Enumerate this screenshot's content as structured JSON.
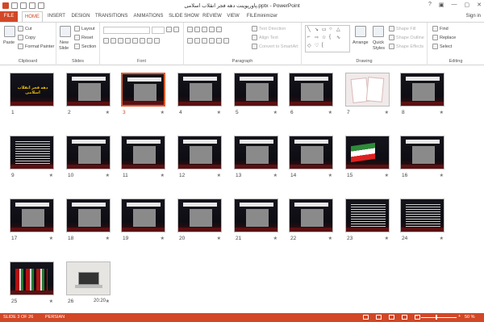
{
  "window": {
    "title": "پاورپوینت دهه فجر انقلاب اسلامی.pptx - PowerPoint",
    "controls": [
      "?",
      "▣",
      "—",
      "▢",
      "✕"
    ]
  },
  "tabs": [
    {
      "label": "FILE"
    },
    {
      "label": "HOME"
    },
    {
      "label": "INSERT"
    },
    {
      "label": "DESIGN"
    },
    {
      "label": "TRANSITIONS"
    },
    {
      "label": "ANIMATIONS"
    },
    {
      "label": "SLIDE SHOW"
    },
    {
      "label": "REVIEW"
    },
    {
      "label": "VIEW"
    },
    {
      "label": "FILEminimizer"
    }
  ],
  "active_tab": "HOME",
  "signin": "Sign in",
  "ribbon": {
    "clipboard": {
      "label": "Clipboard",
      "paste": "Paste",
      "cut": "Cut",
      "copy": "Copy",
      "format_painter": "Format Painter"
    },
    "slides": {
      "label": "Slides",
      "new_slide": "New",
      "new_slide2": "Slide",
      "layout": "Layout",
      "reset": "Reset",
      "section": "Section"
    },
    "font": {
      "label": "Font"
    },
    "paragraph": {
      "label": "Paragraph",
      "text_direction": "Text Direction",
      "align_text": "Align Text",
      "convert_smartart": "Convert to SmartArt"
    },
    "drawing": {
      "label": "Drawing",
      "arrange": "Arrange",
      "quick_styles": "Quick",
      "quick_styles2": "Styles",
      "shape_fill": "Shape Fill",
      "shape_outline": "Shape Outline",
      "shape_effects": "Shape Effects"
    },
    "editing": {
      "label": "Editing",
      "find": "Find",
      "replace": "Replace",
      "select": "Select"
    }
  },
  "slides": [
    {
      "num": "1",
      "kind": "title",
      "title_text": "دهه فجر انقلاب اسلامی",
      "star": ""
    },
    {
      "num": "2",
      "kind": "photo",
      "star": "★"
    },
    {
      "num": "3",
      "kind": "photo",
      "star": "★",
      "selected": true
    },
    {
      "num": "4",
      "kind": "photo",
      "star": "★"
    },
    {
      "num": "5",
      "kind": "photo",
      "star": "★"
    },
    {
      "num": "6",
      "kind": "photo",
      "star": "★"
    },
    {
      "num": "7",
      "kind": "paper",
      "star": "★"
    },
    {
      "num": "8",
      "kind": "photo",
      "star": "★"
    },
    {
      "num": "9",
      "kind": "text",
      "star": "★"
    },
    {
      "num": "10",
      "kind": "photo",
      "star": "★"
    },
    {
      "num": "11",
      "kind": "photo",
      "star": "★"
    },
    {
      "num": "12",
      "kind": "photo",
      "star": "★"
    },
    {
      "num": "13",
      "kind": "photo",
      "star": "★"
    },
    {
      "num": "14",
      "kind": "photo",
      "star": "★"
    },
    {
      "num": "15",
      "kind": "flag",
      "star": "★"
    },
    {
      "num": "16",
      "kind": "photo",
      "star": "★"
    },
    {
      "num": "17",
      "kind": "photo",
      "star": "★"
    },
    {
      "num": "18",
      "kind": "photo",
      "star": "★"
    },
    {
      "num": "19",
      "kind": "photo",
      "star": "★"
    },
    {
      "num": "20",
      "kind": "photo",
      "star": "★"
    },
    {
      "num": "21",
      "kind": "photo",
      "star": "★"
    },
    {
      "num": "22",
      "kind": "photo",
      "star": "★"
    },
    {
      "num": "23",
      "kind": "text",
      "star": "★"
    },
    {
      "num": "24",
      "kind": "text",
      "star": "★"
    },
    {
      "num": "25",
      "kind": "r25",
      "star": "★"
    },
    {
      "num": "26",
      "kind": "laptop",
      "star": "★",
      "timing": "20:20"
    }
  ],
  "status": {
    "slide_info": "SLIDE 3 OF 26",
    "language": "PERSIAN",
    "zoom_minus": "−",
    "zoom_plus": "+",
    "zoom": "50 %"
  },
  "colors": {
    "accent": "#d24726",
    "selection": "#e05a2b"
  }
}
